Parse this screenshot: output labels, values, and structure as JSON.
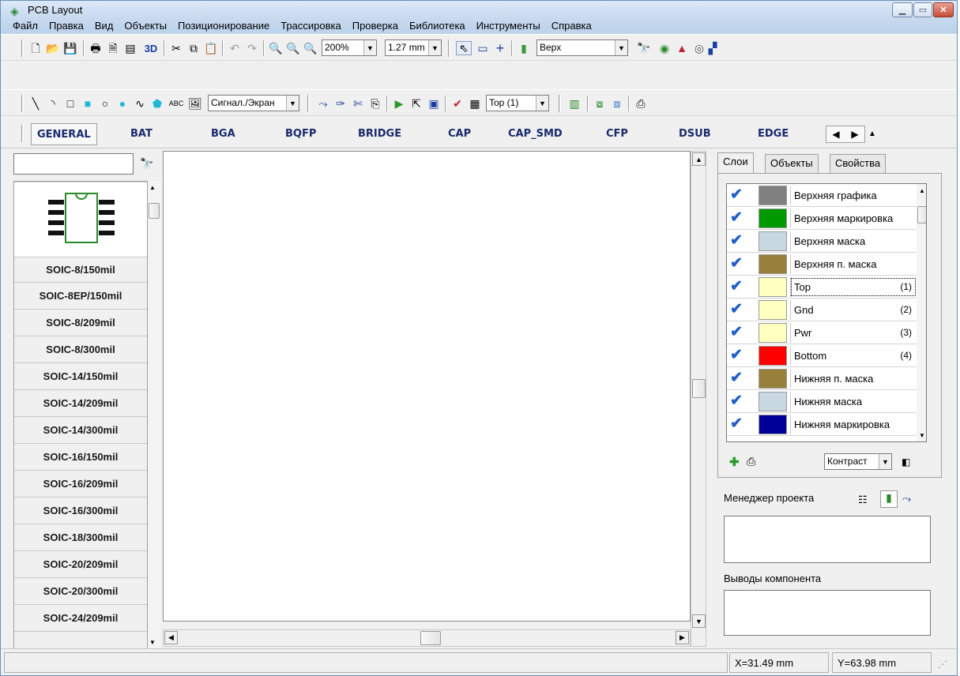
{
  "window": {
    "title": "PCB Layout"
  },
  "menu": [
    "Файл",
    "Правка",
    "Вид",
    "Объекты",
    "Позиционирование",
    "Трассировка",
    "Проверка",
    "Библиотека",
    "Инструменты",
    "Справка"
  ],
  "toolbar1": {
    "zoom": "200%",
    "grid": "1.27 mm",
    "side": "Верх",
    "label_3d": "3D"
  },
  "toolbar2": {
    "mode": "Сигнал./Экран",
    "layer": "Top (1)",
    "text_tool": "ABC"
  },
  "lib_tabs": [
    "GENERAL",
    "BAT",
    "BGA",
    "BQFP",
    "BRIDGE",
    "CAP",
    "CAP_SMD",
    "CFP",
    "DSUB",
    "EDGE"
  ],
  "components": [
    "SOIC-8/150mil",
    "SOIC-8EP/150mil",
    "SOIC-8/209mil",
    "SOIC-8/300mil",
    "SOIC-14/150mil",
    "SOIC-14/209mil",
    "SOIC-14/300mil",
    "SOIC-16/150mil",
    "SOIC-16/209mil",
    "SOIC-16/300mil",
    "SOIC-18/300mil",
    "SOIC-20/209mil",
    "SOIC-20/300mil",
    "SOIC-24/209mil"
  ],
  "right_tabs": [
    "Слои",
    "Объекты",
    "Свойства"
  ],
  "layers": [
    {
      "name": "Верхняя графика",
      "color": "#808080",
      "num": ""
    },
    {
      "name": "Верхняя маркировка",
      "color": "#009900",
      "num": ""
    },
    {
      "name": "Верхняя маска",
      "color": "#c8d8e0",
      "num": ""
    },
    {
      "name": "Верхняя п. маска",
      "color": "#99803a",
      "num": ""
    },
    {
      "name": "Top",
      "color": "#ffffc0",
      "num": "(1)"
    },
    {
      "name": "Gnd",
      "color": "#ffffc0",
      "num": "(2)"
    },
    {
      "name": "Pwr",
      "color": "#ffffc0",
      "num": "(3)"
    },
    {
      "name": "Bottom",
      "color": "#ff0000",
      "num": "(4)"
    },
    {
      "name": "Нижняя п. маска",
      "color": "#99803a",
      "num": ""
    },
    {
      "name": "Нижняя маска",
      "color": "#c8d8e0",
      "num": ""
    },
    {
      "name": "Нижняя маркировка",
      "color": "#000099",
      "num": ""
    }
  ],
  "contrast": "Контраст",
  "project_manager": "Менеджер проекта",
  "component_pins": "Выводы компонента",
  "status": {
    "x": "X=31.49 mm",
    "y": "Y=63.98 mm"
  }
}
